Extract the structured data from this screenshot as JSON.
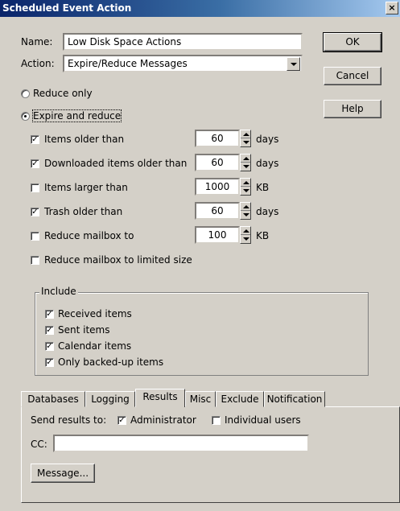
{
  "window": {
    "title": "Scheduled Event Action",
    "close_glyph": "×"
  },
  "form": {
    "name_label": "Name:",
    "name_value": "Low Disk Space Actions",
    "action_label": "Action:",
    "action_value": "Expire/Reduce Messages",
    "mode_options": [
      {
        "label": "Reduce only",
        "selected": false
      },
      {
        "label": "Expire and reduce",
        "selected": true
      }
    ]
  },
  "buttons": {
    "ok": "OK",
    "cancel": "Cancel",
    "help": "Help",
    "message": "Message..."
  },
  "rules": [
    {
      "label": "Items older than",
      "checked": true,
      "value": "60",
      "unit": "days"
    },
    {
      "label": "Downloaded items older than",
      "checked": true,
      "value": "60",
      "unit": "days"
    },
    {
      "label": "Items larger than",
      "checked": false,
      "value": "1000",
      "unit": "KB"
    },
    {
      "label": "Trash older than",
      "checked": true,
      "value": "60",
      "unit": "days"
    },
    {
      "label": "Reduce mailbox to",
      "checked": false,
      "value": "100",
      "unit": "KB"
    },
    {
      "label": "Reduce mailbox to limited size",
      "checked": false
    }
  ],
  "include": {
    "title": "Include",
    "items": [
      {
        "label": "Received items",
        "checked": true
      },
      {
        "label": "Sent items",
        "checked": true
      },
      {
        "label": "Calendar items",
        "checked": true
      },
      {
        "label": "Only backed-up items",
        "checked": true
      }
    ]
  },
  "tabs": [
    {
      "label": "Databases",
      "active": false
    },
    {
      "label": "Logging",
      "active": false
    },
    {
      "label": "Results",
      "active": true
    },
    {
      "label": "Misc",
      "active": false
    },
    {
      "label": "Exclude",
      "active": false
    },
    {
      "label": "Notification",
      "active": false
    }
  ],
  "results": {
    "send_label": "Send results to:",
    "administrator_label": "Administrator",
    "administrator_checked": true,
    "individual_label": "Individual users",
    "individual_checked": false,
    "cc_label": "CC:",
    "cc_value": ""
  },
  "check_glyph": "✓"
}
